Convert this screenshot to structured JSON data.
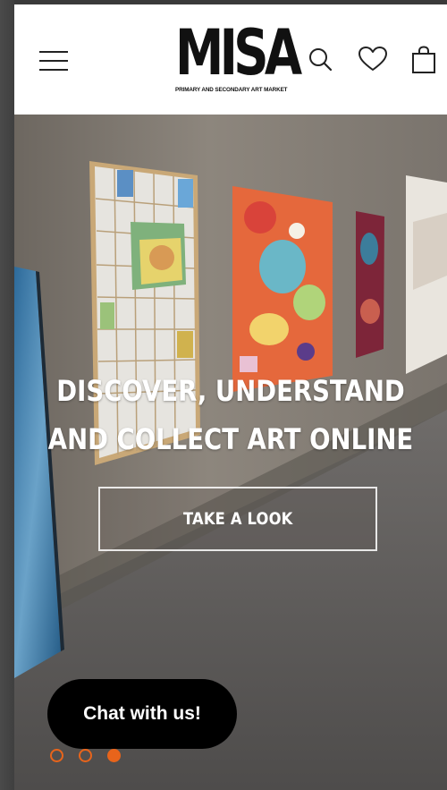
{
  "header": {
    "logo_text": "MISA",
    "logo_tagline": "PRIMARY AND SECONDARY ART MARKET",
    "icons": [
      "menu-icon",
      "search-icon",
      "heart-icon",
      "bag-icon"
    ]
  },
  "hero": {
    "title_line1": "DISCOVER, UNDERSTAND",
    "title_line2": "AND COLLECT ART ONLINE",
    "cta_label": "TAKE A LOOK"
  },
  "chat": {
    "label": "Chat with us!"
  },
  "carousel": {
    "slides": 3,
    "active_index": 2
  },
  "colors": {
    "accent": "#e8641b",
    "chat_bg": "#000000",
    "header_bg": "#ffffff"
  }
}
